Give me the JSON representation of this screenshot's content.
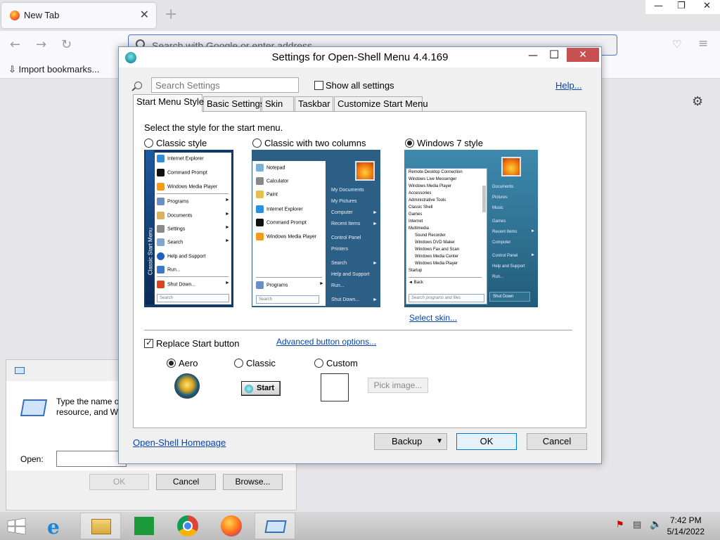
{
  "browser": {
    "tab_title": "New Tab",
    "tab_close": "✕",
    "new_tab": "+",
    "url_placeholder": "Search with Google or enter address",
    "bookmark_import": "Import bookmarks...",
    "win_min": "—",
    "win_restore": "❐",
    "win_close": "✕"
  },
  "run_dialog": {
    "message": "Type the name o\nresource, and Wi",
    "open_label": "Open:",
    "ok": "OK",
    "cancel": "Cancel",
    "browse": "Browse..."
  },
  "settings": {
    "title": "Settings for Open-Shell Menu 4.4.169",
    "min": "—",
    "max": "□",
    "close": "✕",
    "search_placeholder": "Search Settings",
    "show_all": "Show all settings",
    "help": "Help...",
    "tabs": [
      "Start Menu Style",
      "Basic Settings",
      "Skin",
      "Taskbar",
      "Customize Start Menu"
    ],
    "prompt": "Select the style for the start menu.",
    "styles": [
      "Classic style",
      "Classic with two columns",
      "Windows 7 style"
    ],
    "selected_style": "Windows 7 style",
    "select_skin": "Select skin...",
    "replace_start": "Replace Start button",
    "replace_start_checked": true,
    "advanced_button": "Advanced button options...",
    "button_styles": [
      "Aero",
      "Classic",
      "Custom"
    ],
    "selected_button": "Aero",
    "classic_button_text": "Start",
    "pick_image": "Pick image...",
    "homepage": "Open-Shell Homepage",
    "backup": "Backup",
    "ok": "OK",
    "cancel": "Cancel"
  },
  "preview_classic": {
    "side_label": "Classic Start Menu",
    "items": [
      "Internet Explorer",
      "Command Prompt",
      "Windows Media Player",
      "Programs",
      "Documents",
      "Settings",
      "Search",
      "Help and Support",
      "Run...",
      "Shut Down..."
    ],
    "search": "Search"
  },
  "preview_two_col": {
    "left_items": [
      "Notepad",
      "Calculator",
      "Paint",
      "Internet Explorer",
      "Command Prompt",
      "Windows Media Player"
    ],
    "programs": "Programs",
    "right_items": [
      "My Documents",
      "My Pictures",
      "Computer",
      "Recent Items",
      "Control Panel",
      "Printers",
      "Search",
      "Help and Support",
      "Run...",
      "Shut Down..."
    ],
    "search": "Search"
  },
  "preview_win7": {
    "left_items": [
      "Remote Desktop Connection",
      "Windows Live Messenger",
      "Windows Media Player",
      "Accessories",
      "Administrative Tools",
      "Classic Shell",
      "Games",
      "Internet",
      "Multimedia",
      "Sound Recorder",
      "Windows DVD Maker",
      "Windows Fax and Scan",
      "Windows Media Center",
      "Windows Media Player",
      "Startup",
      "Back"
    ],
    "right_items": [
      "Documents",
      "Pictures",
      "Music",
      "Games",
      "Recent Items",
      "Computer",
      "Control Panel",
      "Help and Support",
      "Run..."
    ],
    "shutdown": "Shut Down",
    "search": "Search programs and files"
  },
  "taskbar": {
    "time": "7:42 PM",
    "date": "5/14/2022"
  },
  "colors": {
    "classic_bg": "#0e3a6e",
    "win7_right": "#2a6d8e",
    "link": "#0645ad",
    "close_red": "#c75050"
  }
}
